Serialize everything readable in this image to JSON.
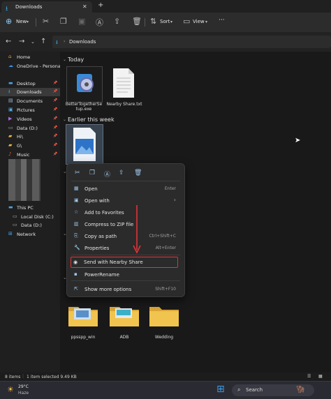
{
  "window": {
    "tab_title": "Downloads"
  },
  "commandbar": {
    "new_label": "New",
    "sort_label": "Sort",
    "view_label": "View",
    "more_label": "···"
  },
  "address": {
    "path": "Downloads"
  },
  "sidebar": {
    "items": [
      {
        "label": "Home",
        "icon": "home-icon"
      },
      {
        "label": "OneDrive - Personal",
        "icon": "cloud-icon"
      },
      {
        "label": "Desktop",
        "icon": "desktop-icon",
        "pinned": true
      },
      {
        "label": "Downloads",
        "icon": "download-icon",
        "pinned": true,
        "selected": true
      },
      {
        "label": "Documents",
        "icon": "document-icon",
        "pinned": true
      },
      {
        "label": "Pictures",
        "icon": "picture-icon",
        "pinned": true
      },
      {
        "label": "Videos",
        "icon": "video-icon",
        "pinned": true
      },
      {
        "label": "Data (D:)",
        "icon": "drive-icon",
        "pinned": true
      },
      {
        "label": "Hi\\",
        "icon": "folder-icon",
        "pinned": true
      },
      {
        "label": "G\\",
        "icon": "folder-icon",
        "pinned": true
      },
      {
        "label": "Music",
        "icon": "music-icon",
        "pinned": true
      }
    ],
    "thispc": {
      "label": "This PC"
    },
    "drives": [
      {
        "label": "Local Disk (C:)"
      },
      {
        "label": "Data (D:)"
      }
    ],
    "network": {
      "label": "Network"
    }
  },
  "main": {
    "today_header": "Today",
    "earlier_header": "Earlier this week",
    "today_files": [
      {
        "name": "BetterTogetherSetup.exe",
        "line1": "BetterTogetherSe",
        "line2": "tup.exe"
      },
      {
        "name": "Nearby Share.txt",
        "line1": "Nearby Share.txt",
        "line2": ""
      }
    ],
    "folders": [
      {
        "name": "ppsspp_win"
      },
      {
        "name": "ADB"
      },
      {
        "name": "Wedding"
      }
    ]
  },
  "context_menu": {
    "items": [
      {
        "label": "Open",
        "shortcut": "Enter",
        "icon": "open-icon"
      },
      {
        "label": "Open with",
        "shortcut": "›",
        "icon": "open-with-icon"
      },
      {
        "label": "Add to Favorites",
        "shortcut": "",
        "icon": "star-icon"
      },
      {
        "label": "Compress to ZIP file",
        "shortcut": "",
        "icon": "zip-icon"
      },
      {
        "label": "Copy as path",
        "shortcut": "Ctrl+Shift+C",
        "icon": "copy-path-icon"
      },
      {
        "label": "Properties",
        "shortcut": "Alt+Enter",
        "icon": "properties-icon"
      },
      {
        "label": "Send with Nearby Share",
        "shortcut": "",
        "icon": "nearby-share-icon",
        "highlighted": true
      },
      {
        "label": "PowerRename",
        "shortcut": "",
        "icon": "rename-icon"
      },
      {
        "label": "Show more options",
        "shortcut": "Shift+F10",
        "icon": "more-options-icon"
      }
    ]
  },
  "status": {
    "count": "8 items",
    "selected": "1 item selected  9.49 KB"
  },
  "taskbar": {
    "temp": "29°C",
    "weather": "Haze",
    "search_placeholder": "Search"
  },
  "colors": {
    "accent": "#3bb0e6",
    "highlight_border": "#e2333a",
    "folder": "#e8b94a"
  }
}
